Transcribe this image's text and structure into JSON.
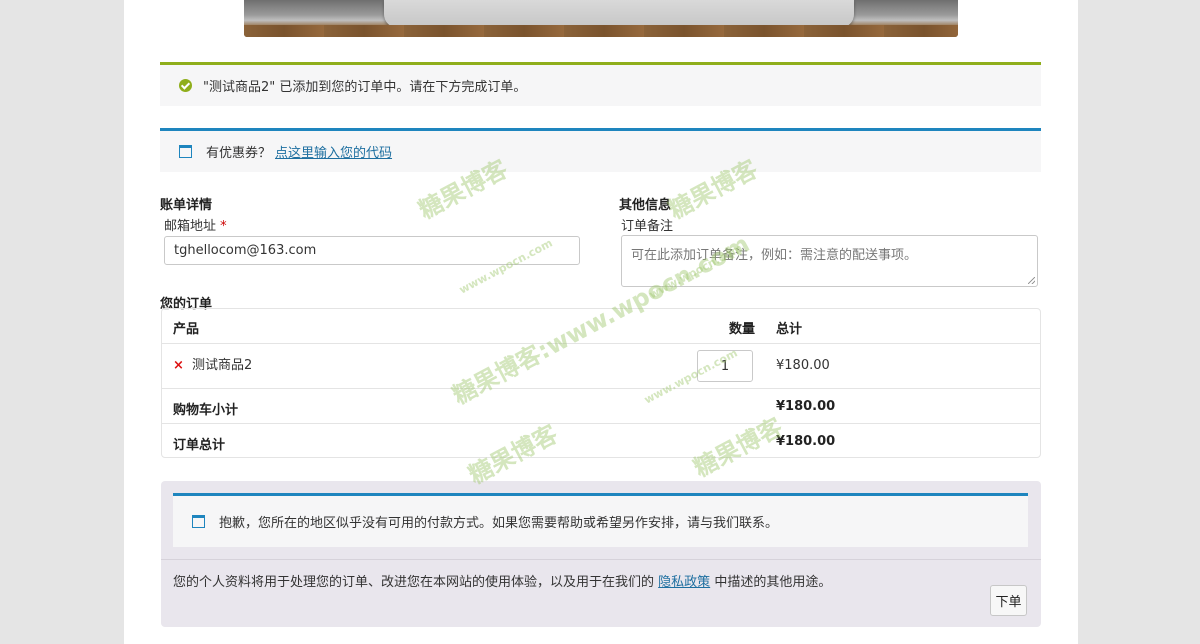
{
  "notices": {
    "success_text": "\"测试商品2\" 已添加到您的订单中。请在下方完成订单。",
    "coupon_prefix": "有优惠券？",
    "coupon_link": "点这里输入您的代码"
  },
  "billing": {
    "heading": "账单详情",
    "email_label": "邮箱地址",
    "required_mark": "*",
    "email_value": "tghellocom@163.com"
  },
  "additional": {
    "heading": "其他信息",
    "notes_label": "订单备注",
    "notes_placeholder": "可在此添加订单备注，例如：需注意的配送事项。"
  },
  "order": {
    "heading": "您的订单",
    "col_product": "产品",
    "col_quantity": "数量",
    "col_total": "总计",
    "items": [
      {
        "remove": "×",
        "name": "测试商品2",
        "quantity": "1",
        "total": "¥180.00"
      }
    ],
    "subtotal_label": "购物车小计",
    "subtotal_value": "¥180.00",
    "total_label": "订单总计",
    "total_value": "¥180.00"
  },
  "payment": {
    "notice": "抱歉，您所在的地区似乎没有可用的付款方式。如果您需要帮助或希望另作安排，请与我们联系。",
    "privacy_prefix": "您的个人资料将用于处理您的订单、改进您在本网站的使用体验，以及用于在我们的",
    "privacy_link": "隐私政策",
    "privacy_suffix": "中描述的其他用途。",
    "place_order": "下单"
  },
  "watermarks": {
    "brand": "糖果博客",
    "url": "www.wpocn.com",
    "combined": "糖果博客:www.wpocn.com"
  },
  "colors": {
    "success_accent": "#8fae1b",
    "info_accent": "#1e85be",
    "required": "#cc0000",
    "remove": "#dd1111",
    "link": "#1e6fa0"
  }
}
